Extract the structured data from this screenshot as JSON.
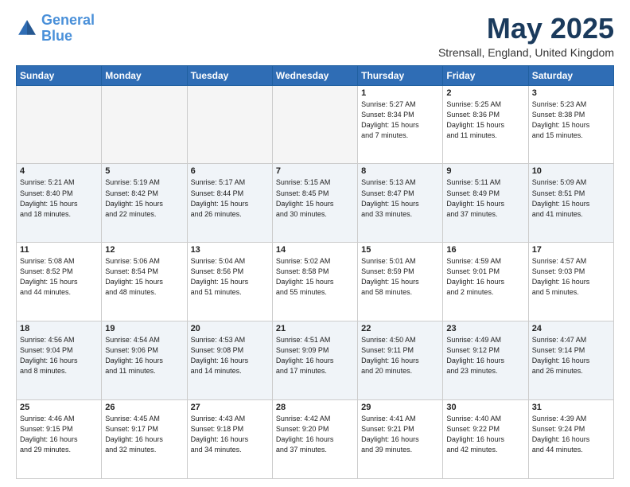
{
  "header": {
    "logo_line1": "General",
    "logo_line2": "Blue",
    "month_title": "May 2025",
    "location": "Strensall, England, United Kingdom"
  },
  "weekdays": [
    "Sunday",
    "Monday",
    "Tuesday",
    "Wednesday",
    "Thursday",
    "Friday",
    "Saturday"
  ],
  "weeks": [
    [
      {
        "day": "",
        "info": ""
      },
      {
        "day": "",
        "info": ""
      },
      {
        "day": "",
        "info": ""
      },
      {
        "day": "",
        "info": ""
      },
      {
        "day": "1",
        "info": "Sunrise: 5:27 AM\nSunset: 8:34 PM\nDaylight: 15 hours\nand 7 minutes."
      },
      {
        "day": "2",
        "info": "Sunrise: 5:25 AM\nSunset: 8:36 PM\nDaylight: 15 hours\nand 11 minutes."
      },
      {
        "day": "3",
        "info": "Sunrise: 5:23 AM\nSunset: 8:38 PM\nDaylight: 15 hours\nand 15 minutes."
      }
    ],
    [
      {
        "day": "4",
        "info": "Sunrise: 5:21 AM\nSunset: 8:40 PM\nDaylight: 15 hours\nand 18 minutes."
      },
      {
        "day": "5",
        "info": "Sunrise: 5:19 AM\nSunset: 8:42 PM\nDaylight: 15 hours\nand 22 minutes."
      },
      {
        "day": "6",
        "info": "Sunrise: 5:17 AM\nSunset: 8:44 PM\nDaylight: 15 hours\nand 26 minutes."
      },
      {
        "day": "7",
        "info": "Sunrise: 5:15 AM\nSunset: 8:45 PM\nDaylight: 15 hours\nand 30 minutes."
      },
      {
        "day": "8",
        "info": "Sunrise: 5:13 AM\nSunset: 8:47 PM\nDaylight: 15 hours\nand 33 minutes."
      },
      {
        "day": "9",
        "info": "Sunrise: 5:11 AM\nSunset: 8:49 PM\nDaylight: 15 hours\nand 37 minutes."
      },
      {
        "day": "10",
        "info": "Sunrise: 5:09 AM\nSunset: 8:51 PM\nDaylight: 15 hours\nand 41 minutes."
      }
    ],
    [
      {
        "day": "11",
        "info": "Sunrise: 5:08 AM\nSunset: 8:52 PM\nDaylight: 15 hours\nand 44 minutes."
      },
      {
        "day": "12",
        "info": "Sunrise: 5:06 AM\nSunset: 8:54 PM\nDaylight: 15 hours\nand 48 minutes."
      },
      {
        "day": "13",
        "info": "Sunrise: 5:04 AM\nSunset: 8:56 PM\nDaylight: 15 hours\nand 51 minutes."
      },
      {
        "day": "14",
        "info": "Sunrise: 5:02 AM\nSunset: 8:58 PM\nDaylight: 15 hours\nand 55 minutes."
      },
      {
        "day": "15",
        "info": "Sunrise: 5:01 AM\nSunset: 8:59 PM\nDaylight: 15 hours\nand 58 minutes."
      },
      {
        "day": "16",
        "info": "Sunrise: 4:59 AM\nSunset: 9:01 PM\nDaylight: 16 hours\nand 2 minutes."
      },
      {
        "day": "17",
        "info": "Sunrise: 4:57 AM\nSunset: 9:03 PM\nDaylight: 16 hours\nand 5 minutes."
      }
    ],
    [
      {
        "day": "18",
        "info": "Sunrise: 4:56 AM\nSunset: 9:04 PM\nDaylight: 16 hours\nand 8 minutes."
      },
      {
        "day": "19",
        "info": "Sunrise: 4:54 AM\nSunset: 9:06 PM\nDaylight: 16 hours\nand 11 minutes."
      },
      {
        "day": "20",
        "info": "Sunrise: 4:53 AM\nSunset: 9:08 PM\nDaylight: 16 hours\nand 14 minutes."
      },
      {
        "day": "21",
        "info": "Sunrise: 4:51 AM\nSunset: 9:09 PM\nDaylight: 16 hours\nand 17 minutes."
      },
      {
        "day": "22",
        "info": "Sunrise: 4:50 AM\nSunset: 9:11 PM\nDaylight: 16 hours\nand 20 minutes."
      },
      {
        "day": "23",
        "info": "Sunrise: 4:49 AM\nSunset: 9:12 PM\nDaylight: 16 hours\nand 23 minutes."
      },
      {
        "day": "24",
        "info": "Sunrise: 4:47 AM\nSunset: 9:14 PM\nDaylight: 16 hours\nand 26 minutes."
      }
    ],
    [
      {
        "day": "25",
        "info": "Sunrise: 4:46 AM\nSunset: 9:15 PM\nDaylight: 16 hours\nand 29 minutes."
      },
      {
        "day": "26",
        "info": "Sunrise: 4:45 AM\nSunset: 9:17 PM\nDaylight: 16 hours\nand 32 minutes."
      },
      {
        "day": "27",
        "info": "Sunrise: 4:43 AM\nSunset: 9:18 PM\nDaylight: 16 hours\nand 34 minutes."
      },
      {
        "day": "28",
        "info": "Sunrise: 4:42 AM\nSunset: 9:20 PM\nDaylight: 16 hours\nand 37 minutes."
      },
      {
        "day": "29",
        "info": "Sunrise: 4:41 AM\nSunset: 9:21 PM\nDaylight: 16 hours\nand 39 minutes."
      },
      {
        "day": "30",
        "info": "Sunrise: 4:40 AM\nSunset: 9:22 PM\nDaylight: 16 hours\nand 42 minutes."
      },
      {
        "day": "31",
        "info": "Sunrise: 4:39 AM\nSunset: 9:24 PM\nDaylight: 16 hours\nand 44 minutes."
      }
    ]
  ]
}
